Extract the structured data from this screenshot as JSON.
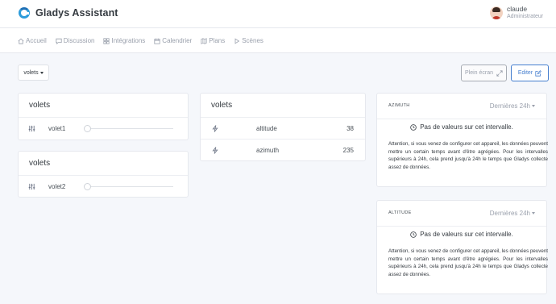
{
  "app": {
    "name": "Gladys Assistant"
  },
  "user": {
    "name": "claude",
    "role": "Administrateur"
  },
  "nav": [
    {
      "label": "Accueil",
      "icon": "home-icon"
    },
    {
      "label": "Discussion",
      "icon": "message-icon"
    },
    {
      "label": "Intégrations",
      "icon": "grid-icon"
    },
    {
      "label": "Calendrier",
      "icon": "calendar-icon"
    },
    {
      "label": "Plans",
      "icon": "map-icon"
    },
    {
      "label": "Scènes",
      "icon": "play-icon"
    }
  ],
  "toolbar": {
    "dashboard_select": "volets",
    "fullscreen_label": "Plein écran",
    "edit_label": "Editer"
  },
  "cards": {
    "volets1": {
      "title": "volets",
      "device": "volet1",
      "level": 0
    },
    "volets2": {
      "title": "volets",
      "device": "volet2",
      "level": 0
    },
    "sensors": {
      "title": "volets",
      "rows": [
        {
          "name": "altitude",
          "value": "38"
        },
        {
          "name": "azimuth",
          "value": "235"
        }
      ]
    },
    "chart_azimuth": {
      "title": "AZIMUTH",
      "period": "Dernières 24h",
      "empty": "Pas de valeurs sur cet intervalle.",
      "note": "Attention, si vous venez de configurer cet appareil, les données peuvent mettre un certain temps avant d'être agrégées. Pour les intervalles supérieurs à 24h, cela prend jusqu'à 24h le temps que Gladys collecte assez de données."
    },
    "chart_altitude": {
      "title": "ALTITUDE",
      "period": "Dernières 24h",
      "empty": "Pas de valeurs sur cet intervalle.",
      "note": "Attention, si vous venez de configurer cet appareil, les données peuvent mettre un certain temps avant d'être agrégées. Pour les intervalles supérieurs à 24h, cela prend jusqu'à 24h le temps que Gladys collecte assez de données."
    }
  }
}
